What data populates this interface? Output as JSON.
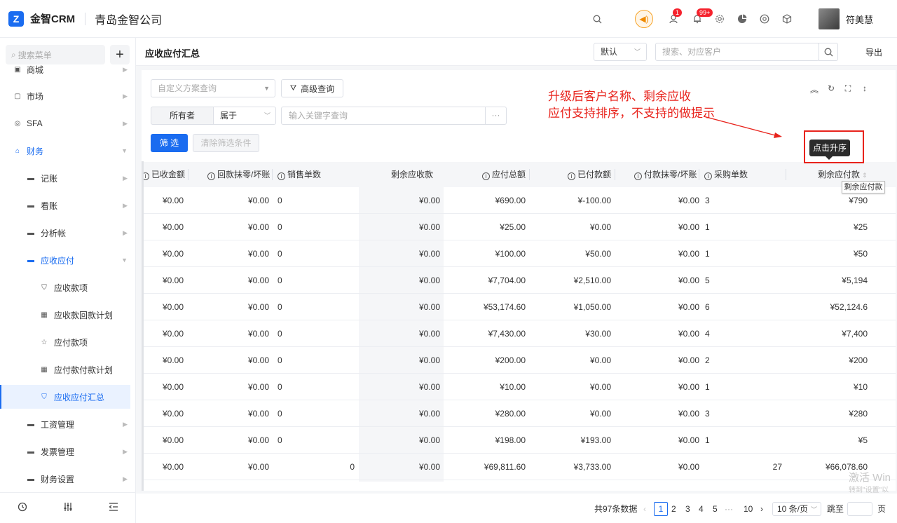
{
  "app": {
    "logo_letter": "Z",
    "name": "金智CRM",
    "company": "青岛金智公司"
  },
  "header": {
    "badge_messages": "1",
    "badge_notifications": "99+",
    "username": "符美慧"
  },
  "sidebar": {
    "search_placeholder": "搜索菜单",
    "add_label": "+",
    "items": [
      {
        "label": "商城"
      },
      {
        "label": "市场"
      },
      {
        "label": "SFA"
      },
      {
        "label": "财务"
      },
      {
        "label": "记账"
      },
      {
        "label": "看账"
      },
      {
        "label": "分析帐"
      },
      {
        "label": "应收应付"
      },
      {
        "label": "应收款项"
      },
      {
        "label": "应收款回款计划"
      },
      {
        "label": "应付款项"
      },
      {
        "label": "应付款付款计划"
      },
      {
        "label": "应收应付汇总"
      },
      {
        "label": "工资管理"
      },
      {
        "label": "发票管理"
      },
      {
        "label": "财务设置"
      }
    ]
  },
  "page": {
    "title": "应收应付汇总",
    "view_select": "默认",
    "search_placeholder": "搜索、对应客户",
    "export_label": "导出"
  },
  "filters": {
    "scheme_placeholder": "自定义方案查询",
    "advanced_label": "高级查询",
    "owner_label": "所有者",
    "operator": "属于",
    "keyword_placeholder": "输入关键字查询",
    "more": "···",
    "filter_button": "筛 选",
    "clear_button": "清除筛选条件"
  },
  "annotation": {
    "line1": "升级后客户名称、剩余应收",
    "line2": "应付支持排序，不支持的做提示"
  },
  "tooltip": {
    "sort_tip": "点击升序",
    "column_tip": "剩余应付款"
  },
  "table": {
    "columns": [
      "已收金额",
      "回款抹零/坏账",
      "销售单数",
      "剩余应收款",
      "应付总额",
      "已付款额",
      "付款抹零/坏账",
      "采购单数",
      "剩余应付款"
    ],
    "rows": [
      [
        "¥0.00",
        "¥0.00",
        "0",
        "¥0.00",
        "¥690.00",
        "¥-100.00",
        "¥0.00",
        "3",
        "¥790"
      ],
      [
        "¥0.00",
        "¥0.00",
        "0",
        "¥0.00",
        "¥25.00",
        "¥0.00",
        "¥0.00",
        "1",
        "¥25"
      ],
      [
        "¥0.00",
        "¥0.00",
        "0",
        "¥0.00",
        "¥100.00",
        "¥50.00",
        "¥0.00",
        "1",
        "¥50"
      ],
      [
        "¥0.00",
        "¥0.00",
        "0",
        "¥0.00",
        "¥7,704.00",
        "¥2,510.00",
        "¥0.00",
        "5",
        "¥5,194"
      ],
      [
        "¥0.00",
        "¥0.00",
        "0",
        "¥0.00",
        "¥53,174.60",
        "¥1,050.00",
        "¥0.00",
        "6",
        "¥52,124.6"
      ],
      [
        "¥0.00",
        "¥0.00",
        "0",
        "¥0.00",
        "¥7,430.00",
        "¥30.00",
        "¥0.00",
        "4",
        "¥7,400"
      ],
      [
        "¥0.00",
        "¥0.00",
        "0",
        "¥0.00",
        "¥200.00",
        "¥0.00",
        "¥0.00",
        "2",
        "¥200"
      ],
      [
        "¥0.00",
        "¥0.00",
        "0",
        "¥0.00",
        "¥10.00",
        "¥0.00",
        "¥0.00",
        "1",
        "¥10"
      ],
      [
        "¥0.00",
        "¥0.00",
        "0",
        "¥0.00",
        "¥280.00",
        "¥0.00",
        "¥0.00",
        "3",
        "¥280"
      ],
      [
        "¥0.00",
        "¥0.00",
        "0",
        "¥0.00",
        "¥198.00",
        "¥193.00",
        "¥0.00",
        "1",
        "¥5"
      ]
    ],
    "total": [
      "¥0.00",
      "¥0.00",
      "0",
      "¥0.00",
      "¥69,811.60",
      "¥3,733.00",
      "¥0.00",
      "27",
      "¥66,078.60"
    ]
  },
  "pagination": {
    "total_text": "共97条数据",
    "pages": [
      "1",
      "2",
      "3",
      "4",
      "5",
      "···",
      "10"
    ],
    "current": "1",
    "page_size": "10 条/页",
    "jump_label": "跳至",
    "page_unit": "页"
  },
  "watermark": {
    "line1": "激活 Win",
    "line2": "转到\"设置\"以"
  }
}
